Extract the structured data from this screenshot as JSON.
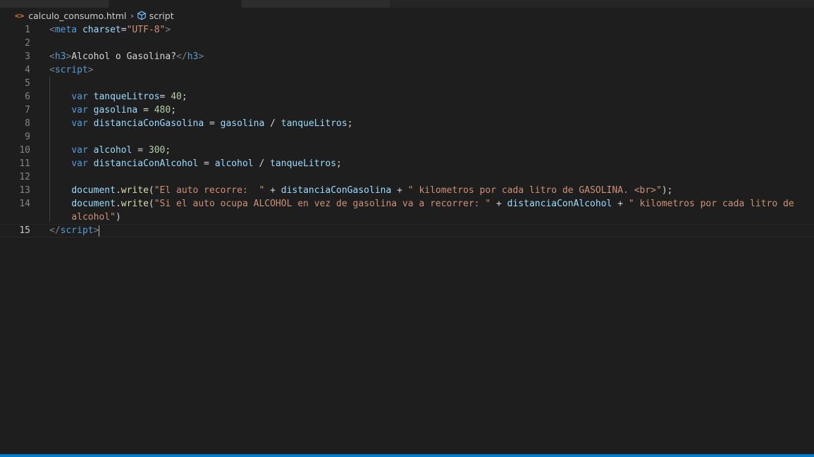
{
  "breadcrumb": {
    "file": "calculo_consumo.html",
    "separator": "›",
    "symbol": "script"
  },
  "editor": {
    "current_line": 15,
    "lines": [
      {
        "n": "1",
        "tokens": [
          {
            "t": "<",
            "c": "#808080"
          },
          {
            "t": "meta",
            "c": "#569cd6"
          },
          {
            "t": " ",
            "c": "#d4d4d4"
          },
          {
            "t": "charset",
            "c": "#9cdcfe"
          },
          {
            "t": "=",
            "c": "#d4d4d4"
          },
          {
            "t": "\"UTF-8\"",
            "c": "#ce9178"
          },
          {
            "t": ">",
            "c": "#808080"
          }
        ]
      },
      {
        "n": "2",
        "tokens": []
      },
      {
        "n": "3",
        "tokens": [
          {
            "t": "<",
            "c": "#808080"
          },
          {
            "t": "h3",
            "c": "#569cd6"
          },
          {
            "t": ">",
            "c": "#808080"
          },
          {
            "t": "Alcohol o Gasolina?",
            "c": "#d4d4d4"
          },
          {
            "t": "</",
            "c": "#808080"
          },
          {
            "t": "h3",
            "c": "#569cd6"
          },
          {
            "t": ">",
            "c": "#808080"
          }
        ]
      },
      {
        "n": "4",
        "tokens": [
          {
            "t": "<",
            "c": "#808080"
          },
          {
            "t": "script",
            "c": "#569cd6"
          },
          {
            "t": ">",
            "c": "#808080"
          }
        ]
      },
      {
        "n": "5",
        "tokens": []
      },
      {
        "n": "6",
        "tokens": [
          {
            "t": "    ",
            "c": "#d4d4d4"
          },
          {
            "t": "var",
            "c": "#569cd6"
          },
          {
            "t": " ",
            "c": "#d4d4d4"
          },
          {
            "t": "tanqueLitros",
            "c": "#9cdcfe"
          },
          {
            "t": "= ",
            "c": "#d4d4d4"
          },
          {
            "t": "40",
            "c": "#b5cea8"
          },
          {
            "t": ";",
            "c": "#d4d4d4"
          }
        ]
      },
      {
        "n": "7",
        "tokens": [
          {
            "t": "    ",
            "c": "#d4d4d4"
          },
          {
            "t": "var",
            "c": "#569cd6"
          },
          {
            "t": " ",
            "c": "#d4d4d4"
          },
          {
            "t": "gasolina",
            "c": "#9cdcfe"
          },
          {
            "t": " = ",
            "c": "#d4d4d4"
          },
          {
            "t": "480",
            "c": "#b5cea8"
          },
          {
            "t": ";",
            "c": "#d4d4d4"
          }
        ]
      },
      {
        "n": "8",
        "tokens": [
          {
            "t": "    ",
            "c": "#d4d4d4"
          },
          {
            "t": "var",
            "c": "#569cd6"
          },
          {
            "t": " ",
            "c": "#d4d4d4"
          },
          {
            "t": "distanciaConGasolina",
            "c": "#9cdcfe"
          },
          {
            "t": " = ",
            "c": "#d4d4d4"
          },
          {
            "t": "gasolina",
            "c": "#9cdcfe"
          },
          {
            "t": " / ",
            "c": "#d4d4d4"
          },
          {
            "t": "tanqueLitros",
            "c": "#9cdcfe"
          },
          {
            "t": ";",
            "c": "#d4d4d4"
          }
        ]
      },
      {
        "n": "9",
        "tokens": []
      },
      {
        "n": "10",
        "tokens": [
          {
            "t": "    ",
            "c": "#d4d4d4"
          },
          {
            "t": "var",
            "c": "#569cd6"
          },
          {
            "t": " ",
            "c": "#d4d4d4"
          },
          {
            "t": "alcohol",
            "c": "#9cdcfe"
          },
          {
            "t": " = ",
            "c": "#d4d4d4"
          },
          {
            "t": "300",
            "c": "#b5cea8"
          },
          {
            "t": ";",
            "c": "#d4d4d4"
          }
        ]
      },
      {
        "n": "11",
        "tokens": [
          {
            "t": "    ",
            "c": "#d4d4d4"
          },
          {
            "t": "var",
            "c": "#569cd6"
          },
          {
            "t": " ",
            "c": "#d4d4d4"
          },
          {
            "t": "distanciaConAlcohol",
            "c": "#9cdcfe"
          },
          {
            "t": " = ",
            "c": "#d4d4d4"
          },
          {
            "t": "alcohol",
            "c": "#9cdcfe"
          },
          {
            "t": " / ",
            "c": "#d4d4d4"
          },
          {
            "t": "tanqueLitros",
            "c": "#9cdcfe"
          },
          {
            "t": ";",
            "c": "#d4d4d4"
          }
        ]
      },
      {
        "n": "12",
        "tokens": []
      },
      {
        "n": "13",
        "tokens": [
          {
            "t": "    ",
            "c": "#d4d4d4"
          },
          {
            "t": "document",
            "c": "#9cdcfe"
          },
          {
            "t": ".",
            "c": "#d4d4d4"
          },
          {
            "t": "write",
            "c": "#dcdcaa"
          },
          {
            "t": "(",
            "c": "#d4d4d4"
          },
          {
            "t": "\"El auto recorre:  \"",
            "c": "#ce9178"
          },
          {
            "t": " + ",
            "c": "#d4d4d4"
          },
          {
            "t": "distanciaConGasolina",
            "c": "#9cdcfe"
          },
          {
            "t": " + ",
            "c": "#d4d4d4"
          },
          {
            "t": "\" kilometros por cada litro de GASOLINA. <br>\"",
            "c": "#ce9178"
          },
          {
            "t": ");",
            "c": "#d4d4d4"
          }
        ]
      },
      {
        "n": "14",
        "tokens": [
          {
            "t": "    ",
            "c": "#d4d4d4"
          },
          {
            "t": "document",
            "c": "#9cdcfe"
          },
          {
            "t": ".",
            "c": "#d4d4d4"
          },
          {
            "t": "write",
            "c": "#dcdcaa"
          },
          {
            "t": "(",
            "c": "#d4d4d4"
          },
          {
            "t": "\"Si el auto ocupa ALCOHOL en vez de gasolina va a recorrer: \"",
            "c": "#ce9178"
          },
          {
            "t": " + ",
            "c": "#d4d4d4"
          },
          {
            "t": "distanciaConAlcohol",
            "c": "#9cdcfe"
          },
          {
            "t": " + ",
            "c": "#d4d4d4"
          },
          {
            "t": "\" kilometros por cada litro de",
            "c": "#ce9178"
          }
        ]
      },
      {
        "n": "",
        "tokens": [
          {
            "t": "    ",
            "c": "#d4d4d4"
          },
          {
            "t": "alcohol\"",
            "c": "#ce9178"
          },
          {
            "t": ")",
            "c": "#d4d4d4"
          }
        ]
      },
      {
        "n": "15",
        "tokens": [
          {
            "t": "</",
            "c": "#808080"
          },
          {
            "t": "script",
            "c": "#569cd6"
          },
          {
            "t": ">",
            "c": "#808080"
          }
        ]
      }
    ]
  }
}
